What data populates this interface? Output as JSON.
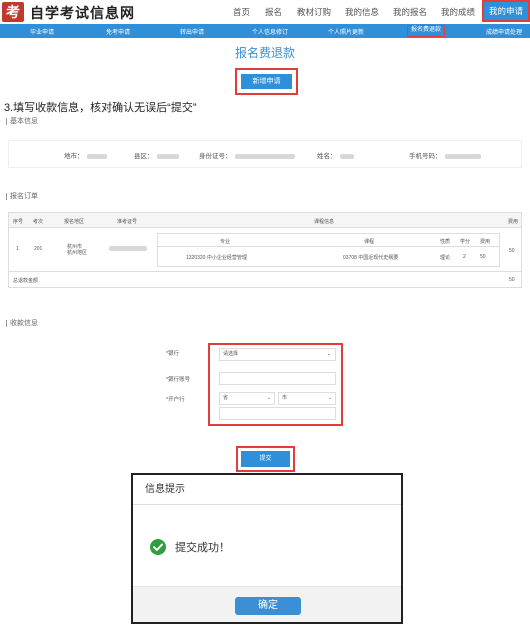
{
  "header": {
    "logo_text": "考",
    "site_title": "自学考试信息网",
    "nav": [
      "首页",
      "报名",
      "教材订购",
      "我的信息",
      "我的报名",
      "我的成绩",
      "我的申请"
    ]
  },
  "subnav": [
    "毕业申请",
    "免考申请",
    "转出申请",
    "个人信息修订",
    "个人照片更新",
    "报名费退款",
    "成绩申请处理"
  ],
  "page_title": "报名费退款",
  "new_button": "新增申请",
  "step_text": "3.填写收款信息，核对确认无误后“提交”",
  "basic_info": {
    "label": "基本信息",
    "fields": [
      "地市：",
      "县区：",
      "身份证号：",
      "姓名：",
      "手机号码："
    ]
  },
  "order": {
    "label": "报名订单",
    "headers": [
      "序号",
      "考次",
      "报名地区",
      "准考证号",
      "课程信息",
      "费用"
    ],
    "row": {
      "index": "1",
      "term": "201",
      "region": "杭州市\n杭州地区",
      "fee": "50"
    },
    "inner_headers": [
      "专业",
      "课程",
      "性质",
      "学分",
      "费用"
    ],
    "inner_row": {
      "major": "1320320 中小企业经营管理",
      "course": "03708 中国近现代史纲要",
      "type": "理论",
      "credit": "2",
      "fee": "50"
    },
    "total_label": "总退款金额",
    "total_value": "50"
  },
  "payee": {
    "label": "收款信息",
    "bank_label": "*银行",
    "bank_value": "请选择",
    "account_label": "*银行账号",
    "branch_label": "*开户行",
    "province": "省",
    "city": "市"
  },
  "submit_button": "提交",
  "dialog": {
    "title": "信息提示",
    "message": "提交成功！",
    "ok": "确定"
  }
}
